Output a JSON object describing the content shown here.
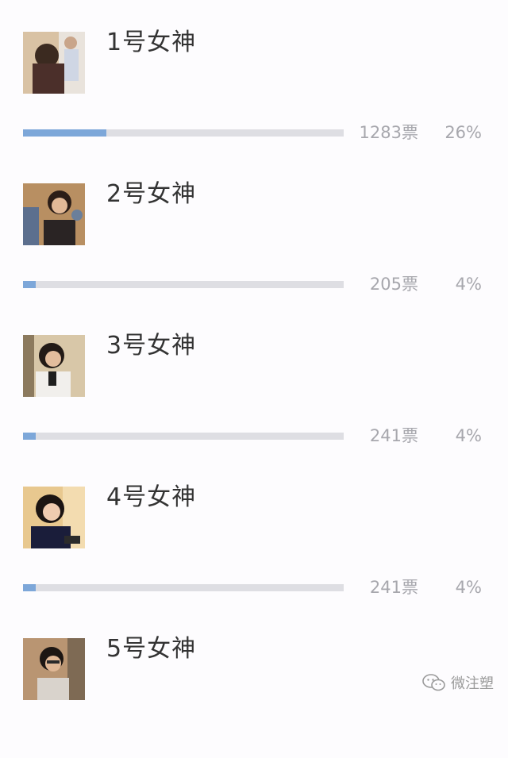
{
  "poll": {
    "items": [
      {
        "name": "1号女神",
        "votes": "1283票",
        "percent": "26%",
        "fill_fraction": 0.26,
        "photo_icon": "avatar-photo"
      },
      {
        "name": "2号女神",
        "votes": "205票",
        "percent": "4%",
        "fill_fraction": 0.04,
        "photo_icon": "avatar-photo"
      },
      {
        "name": "3号女神",
        "votes": "241票",
        "percent": "4%",
        "fill_fraction": 0.04,
        "photo_icon": "avatar-photo"
      },
      {
        "name": "4号女神",
        "votes": "241票",
        "percent": "4%",
        "fill_fraction": 0.04,
        "photo_icon": "avatar-photo"
      },
      {
        "name": "5号女神",
        "votes": null,
        "percent": null,
        "fill_fraction": null,
        "photo_icon": "avatar-photo"
      }
    ]
  },
  "watermark": {
    "text": "微注塑",
    "icon": "wechat-icon"
  },
  "colors": {
    "bar_fill": "#7da7d9",
    "bar_track": "#dedee3",
    "name_text": "#333333",
    "meta_text": "#a7a7ad",
    "background": "#fdfcfe"
  }
}
